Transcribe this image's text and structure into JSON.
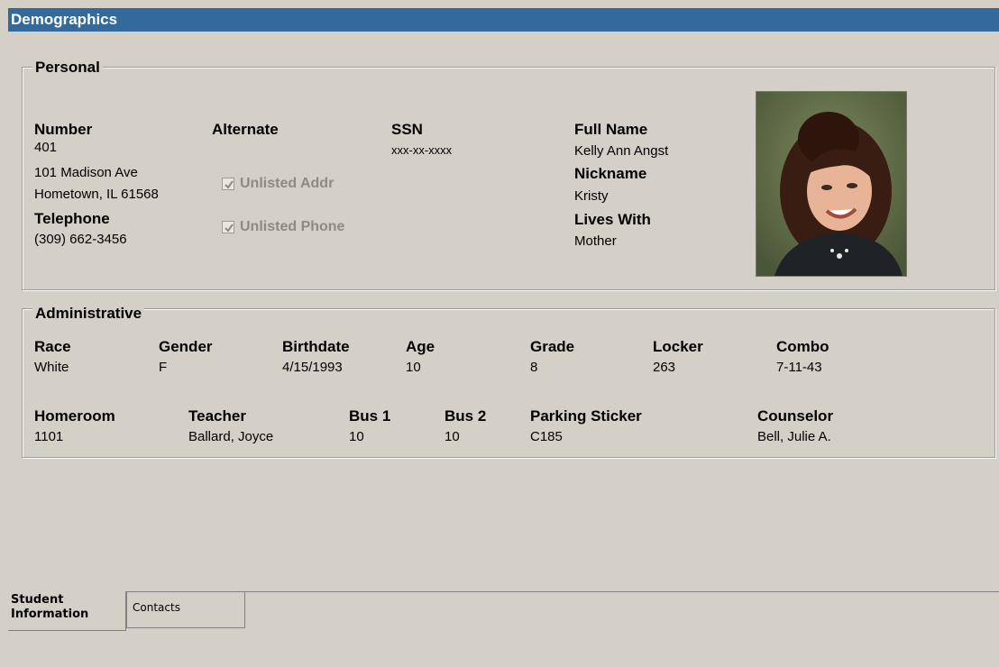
{
  "window": {
    "title": "Demographics"
  },
  "personal": {
    "legend": "Personal",
    "number_label": "Number",
    "number_value": "401",
    "address_line1": "101 Madison Ave",
    "address_line2": "Hometown, IL 61568",
    "telephone_label": "Telephone",
    "telephone_value": "(309) 662-3456",
    "alternate_label": "Alternate",
    "unlisted_addr_label": "Unlisted Addr",
    "unlisted_phone_label": "Unlisted Phone",
    "ssn_label": "SSN",
    "ssn_value": "xxx-xx-xxxx",
    "fullname_label": "Full Name",
    "fullname_value": "Kelly Ann Angst",
    "nickname_label": "Nickname",
    "nickname_value": "Kristy",
    "liveswith_label": "Lives With",
    "liveswith_value": "Mother",
    "unlisted_addr_checked": true,
    "unlisted_phone_checked": true
  },
  "administrative": {
    "legend": "Administrative",
    "race_label": "Race",
    "race_value": "White",
    "gender_label": "Gender",
    "gender_value": "F",
    "birthdate_label": "Birthdate",
    "birthdate_value": "4/15/1993",
    "age_label": "Age",
    "age_value": "10",
    "grade_label": "Grade",
    "grade_value": "8",
    "locker_label": "Locker",
    "locker_value": "263",
    "combo_label": "Combo",
    "combo_value": "7-11-43",
    "homeroom_label": "Homeroom",
    "homeroom_value": "1101",
    "teacher_label": "Teacher",
    "teacher_value": "Ballard, Joyce",
    "bus1_label": "Bus 1",
    "bus1_value": "10",
    "bus2_label": "Bus 2",
    "bus2_value": "10",
    "parking_label": "Parking Sticker",
    "parking_value": "C185",
    "counselor_label": "Counselor",
    "counselor_value": "Bell, Julie A."
  },
  "tabs": {
    "student_information_line1": "Student",
    "student_information_line2": "Information",
    "contacts": "Contacts"
  },
  "colors": {
    "titlebar": "#336a9c",
    "background": "#d4d0c8"
  }
}
